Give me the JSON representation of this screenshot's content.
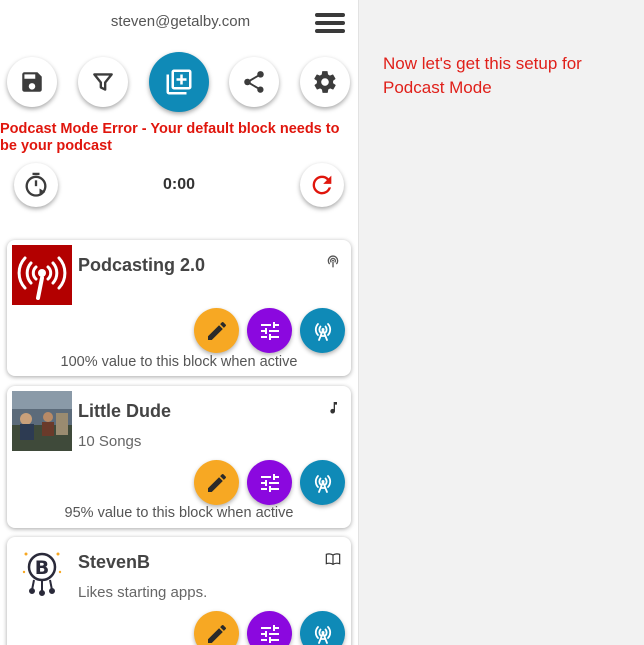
{
  "header": {
    "email": "steven@getalby.com",
    "menu_icon": "hamburger-menu-icon"
  },
  "toolbar": [
    {
      "name": "save-button",
      "icon": "save-icon"
    },
    {
      "name": "filter-button",
      "icon": "filter-icon"
    },
    {
      "name": "add-block-button",
      "icon": "add-library-icon"
    },
    {
      "name": "share-button",
      "icon": "share-icon"
    },
    {
      "name": "settings-button",
      "icon": "gear-icon"
    }
  ],
  "error": {
    "text": "Podcast Mode Error - Your default block needs to be your podcast"
  },
  "player": {
    "time": "0:00",
    "timer_icon": "timer-icon",
    "reset_icon": "reset-icon"
  },
  "blocks": [
    {
      "title": "Podcasting 2.0",
      "subtitle": "",
      "type_icon": "podcast-icon",
      "value_text": "100% value to this block when active"
    },
    {
      "title": "Little Dude",
      "subtitle": "10 Songs",
      "type_icon": "music-note-icon",
      "value_text": "95% value to this block when active"
    },
    {
      "title": "StevenB",
      "subtitle": "Likes starting apps.",
      "type_icon": "book-icon",
      "value_text": ""
    }
  ],
  "colors": {
    "primary": "#0f8ab7",
    "edit": "#f7a823",
    "tune": "#8b08df",
    "error": "#e0160d"
  },
  "note": {
    "text": "Now let's get this setup for Podcast Mode"
  }
}
